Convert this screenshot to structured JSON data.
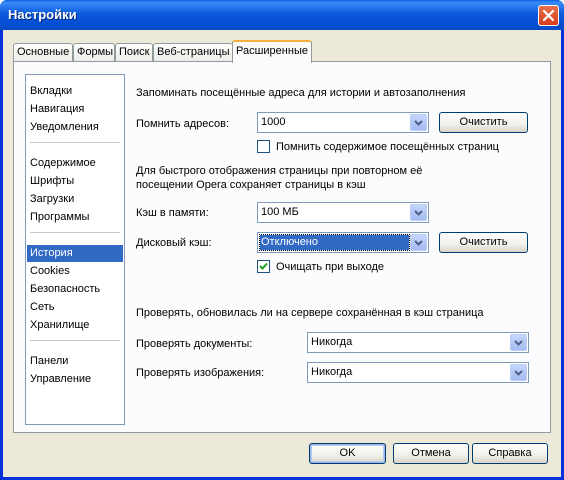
{
  "window": {
    "title": "Настройки"
  },
  "tabs": [
    {
      "label": "Основные"
    },
    {
      "label": "Формы"
    },
    {
      "label": "Поиск"
    },
    {
      "label": "Веб-страницы"
    },
    {
      "label": "Расширенные"
    }
  ],
  "active_tab": "Расширенные",
  "sidebar": {
    "groups": [
      [
        "Вкладки",
        "Навигация",
        "Уведомления"
      ],
      [
        "Содержимое",
        "Шрифты",
        "Загрузки",
        "Программы"
      ],
      [
        "История",
        "Cookies",
        "Безопасность",
        "Сеть",
        "Хранилище"
      ],
      [
        "Панели",
        "Управление"
      ]
    ],
    "selected": "История"
  },
  "history": {
    "section_title": "Запоминать посещённые адреса для истории и автозаполнения",
    "remember_label": "Помнить адресов:",
    "remember_value": "1000",
    "clear_label": "Очистить",
    "remember_content_label": "Помнить содержимое посещённых страниц",
    "remember_content_checked": false
  },
  "cache": {
    "description_line1": "Для быстрого отображения страницы при повторном её",
    "description_line2": "посещении Opera сохраняет страницы в кэш",
    "memory_label": "Кэш в памяти:",
    "memory_value": "100 МБ",
    "disk_label": "Дисковый кэш:",
    "disk_value": "Отключено",
    "clear_label": "Очистить",
    "clear_on_exit_label": "Очищать при выходе",
    "clear_on_exit_checked": true
  },
  "check": {
    "section_title": "Проверять, обновилась ли на сервере сохранённая в кэш страница",
    "documents_label": "Проверять документы:",
    "documents_value": "Никогда",
    "images_label": "Проверять изображения:",
    "images_value": "Никогда"
  },
  "footer": {
    "ok_label": "OK",
    "cancel_label": "Отмена",
    "help_label": "Справка"
  }
}
